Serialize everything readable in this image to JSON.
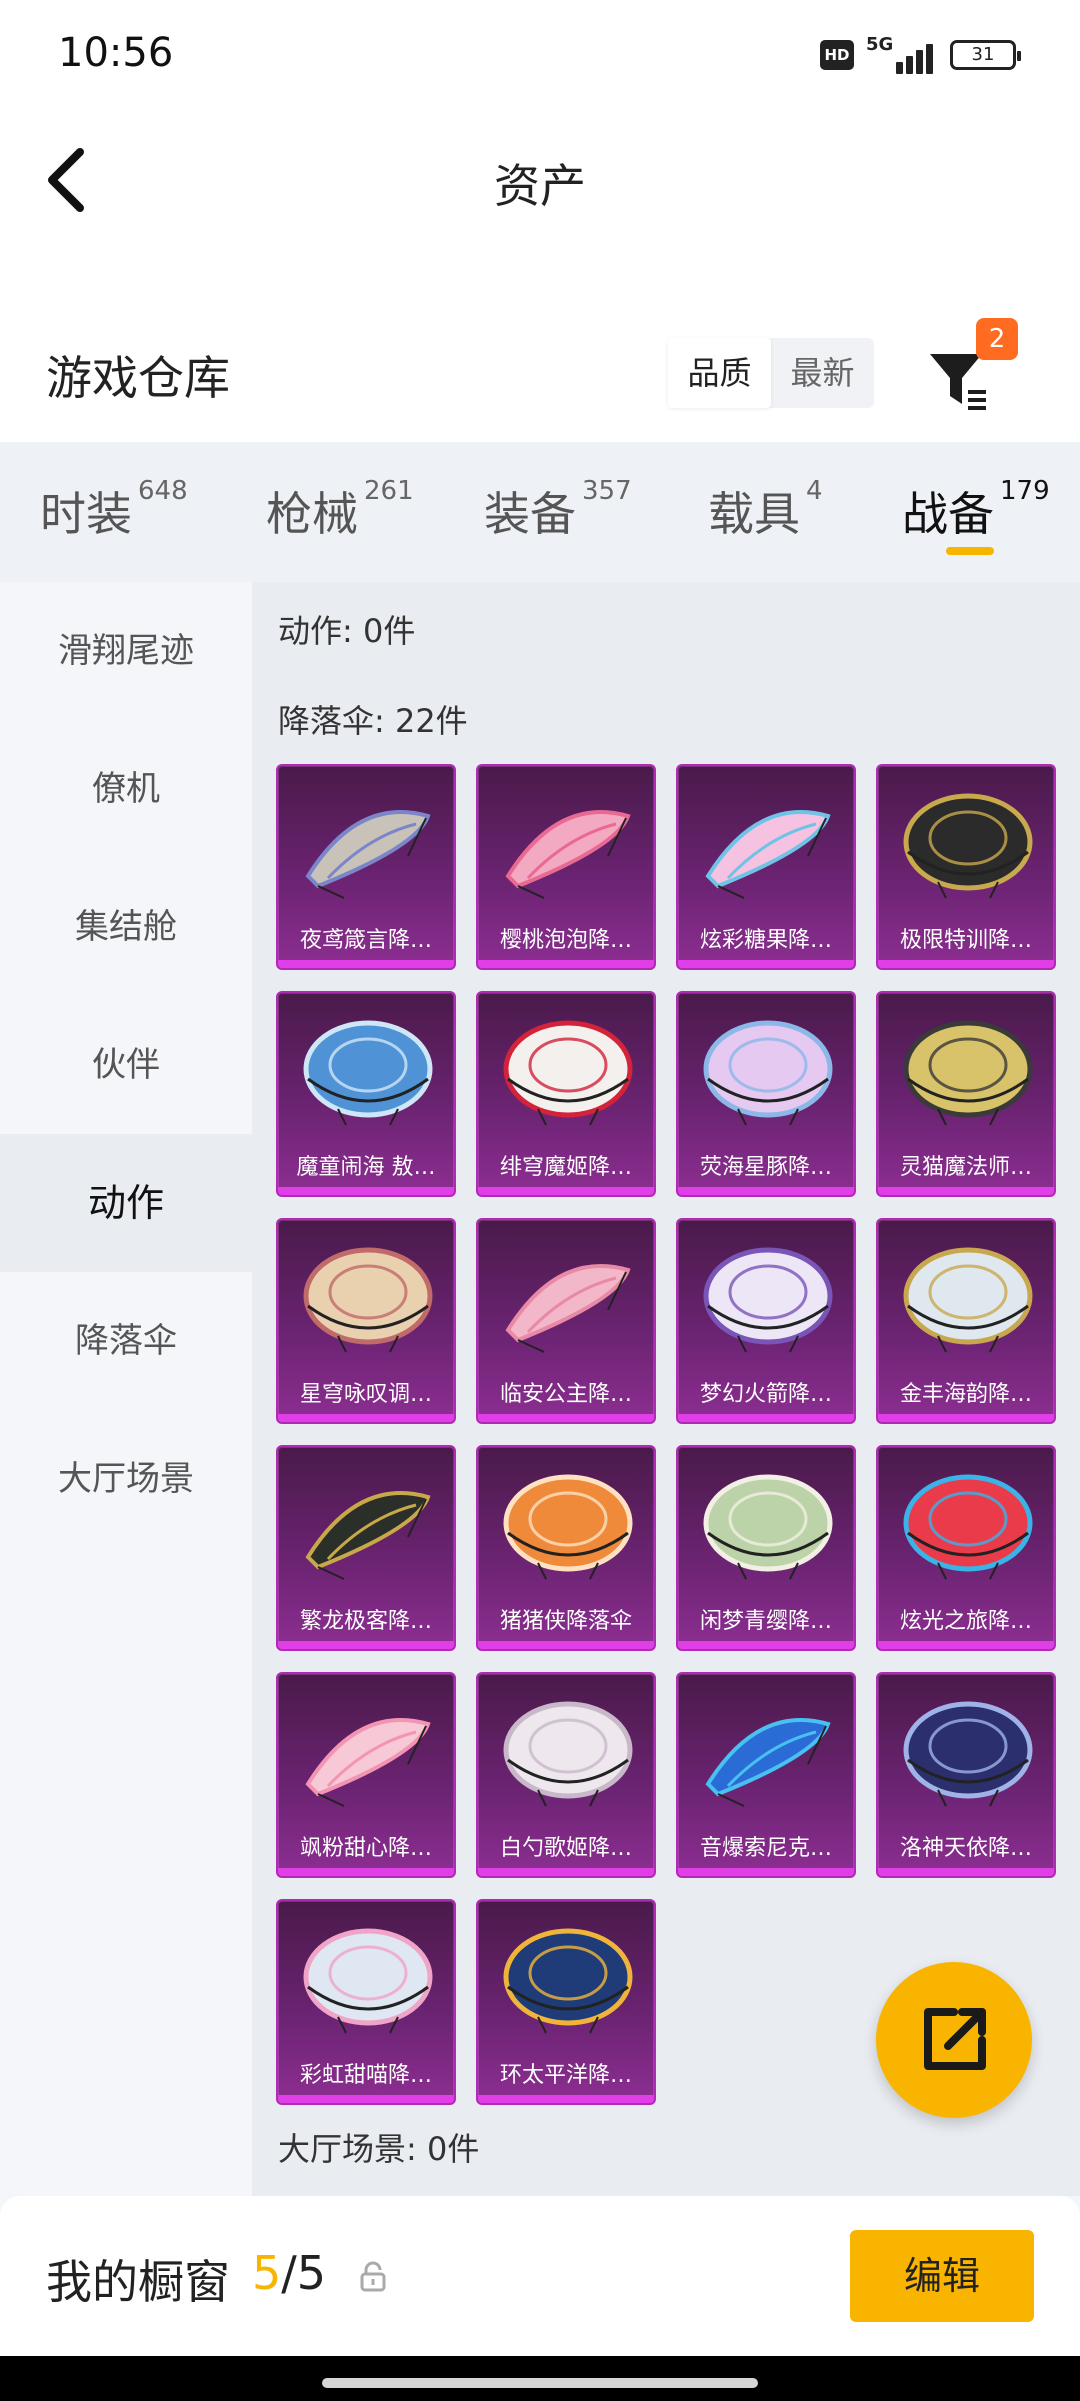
{
  "status": {
    "time": "10:56",
    "hd": "HD",
    "network": "5G",
    "battery": "31"
  },
  "header": {
    "title": "资产"
  },
  "section": {
    "title": "游戏仓库",
    "sort_quality": "品质",
    "sort_newest": "最新",
    "filter_badge": "2"
  },
  "tabs": [
    {
      "label": "时装",
      "count": "648"
    },
    {
      "label": "枪械",
      "count": "261"
    },
    {
      "label": "装备",
      "count": "357"
    },
    {
      "label": "载具",
      "count": "4"
    },
    {
      "label": "战备",
      "count": "179"
    }
  ],
  "sidebar": [
    {
      "label": "滑翔尾迹"
    },
    {
      "label": "僚机"
    },
    {
      "label": "集结舱"
    },
    {
      "label": "伙伴"
    },
    {
      "label": "动作"
    },
    {
      "label": "降落伞"
    },
    {
      "label": "大厅场景"
    }
  ],
  "content": {
    "actions_label": "动作: 0件",
    "parachute_label": "降落伞: 22件",
    "lobby_label": "大厅场景: 0件",
    "items": [
      {
        "name": "夜鸢箴言降…"
      },
      {
        "name": "樱桃泡泡降…"
      },
      {
        "name": "炫彩糖果降…"
      },
      {
        "name": "极限特训降…"
      },
      {
        "name": "魔童闹海 敖…"
      },
      {
        "name": "绯穹魔姬降…"
      },
      {
        "name": "荧海星豚降…"
      },
      {
        "name": "灵猫魔法师…"
      },
      {
        "name": "星穹咏叹调…"
      },
      {
        "name": "临安公主降…"
      },
      {
        "name": "梦幻火箭降…"
      },
      {
        "name": "金丰海韵降…"
      },
      {
        "name": "繁龙极客降…"
      },
      {
        "name": "猪猪侠降落伞"
      },
      {
        "name": "闲梦青缨降…"
      },
      {
        "name": "炫光之旅降…"
      },
      {
        "name": "飒粉甜心降…"
      },
      {
        "name": "白勺歌姬降…"
      },
      {
        "name": "音爆索尼克…"
      },
      {
        "name": "洛神天依降…"
      },
      {
        "name": "彩虹甜喵降…"
      },
      {
        "name": "环太平洋降…"
      }
    ]
  },
  "bottom": {
    "label": "我的橱窗",
    "count_current": "5",
    "count_sep_total": "/5",
    "edit_label": "编辑"
  },
  "colors": {
    "accent": "#f9b400",
    "badge": "#ff6b21",
    "card_border": "#b02bb5"
  }
}
